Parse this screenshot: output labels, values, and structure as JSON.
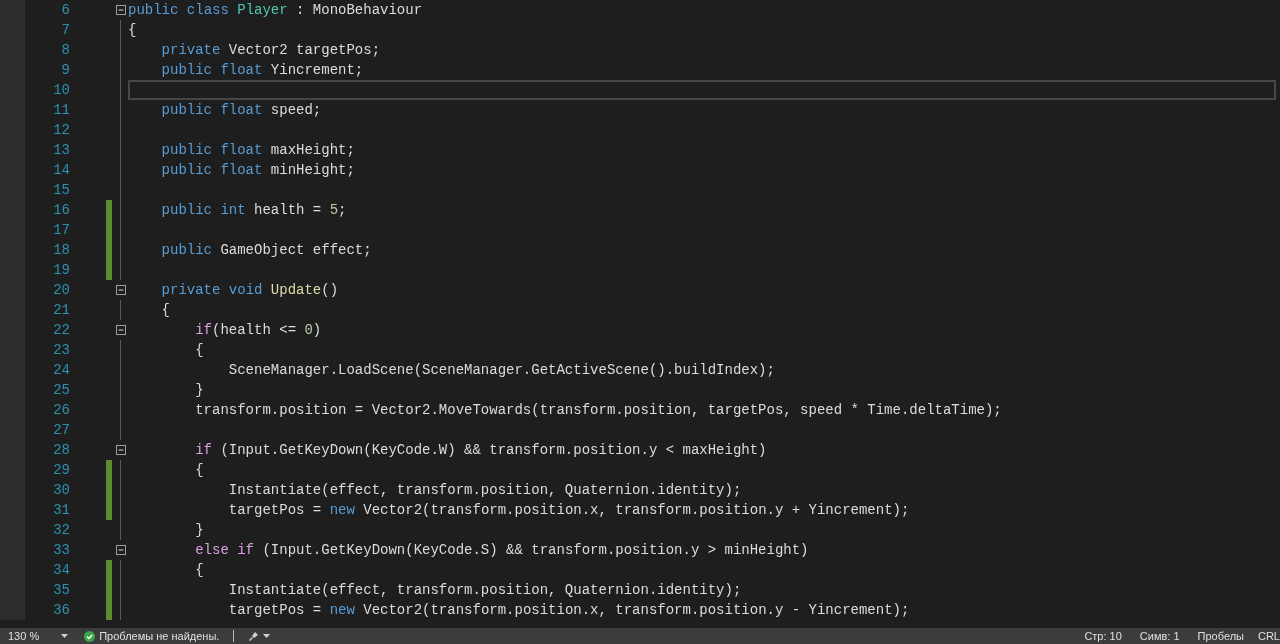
{
  "lines": [
    {
      "number": "6",
      "fold": true,
      "changed": false,
      "current": false,
      "tokens": [
        {
          "kind": "kw",
          "text": "public"
        },
        {
          "kind": "kw",
          "text": " class"
        },
        {
          "kind": "type",
          "text": " Player"
        },
        {
          "kind": "plain",
          "text": " : MonoBehaviour"
        }
      ]
    },
    {
      "number": "7",
      "fold": false,
      "changed": false,
      "current": false,
      "tokens": [
        {
          "kind": "plain",
          "text": "{"
        }
      ]
    },
    {
      "number": "8",
      "fold": false,
      "changed": false,
      "current": false,
      "tokens": [
        {
          "kind": "kw",
          "text": "    private"
        },
        {
          "kind": "plain",
          "text": " Vector2 targetPos;"
        }
      ]
    },
    {
      "number": "9",
      "fold": false,
      "changed": false,
      "current": false,
      "tokens": [
        {
          "kind": "kw",
          "text": "    public"
        },
        {
          "kind": "kw",
          "text": " float"
        },
        {
          "kind": "plain",
          "text": " Yincrement;"
        }
      ]
    },
    {
      "number": "10",
      "fold": false,
      "changed": false,
      "current": true
    },
    {
      "number": "11",
      "fold": false,
      "changed": false,
      "current": false,
      "tokens": [
        {
          "kind": "kw",
          "text": "    public"
        },
        {
          "kind": "kw",
          "text": " float"
        },
        {
          "kind": "plain",
          "text": " speed;"
        }
      ]
    },
    {
      "number": "12",
      "fold": false,
      "changed": false,
      "current": false
    },
    {
      "number": "13",
      "fold": false,
      "changed": false,
      "current": false,
      "tokens": [
        {
          "kind": "kw",
          "text": "    public"
        },
        {
          "kind": "kw",
          "text": " float"
        },
        {
          "kind": "plain",
          "text": " maxHeight;"
        }
      ]
    },
    {
      "number": "14",
      "fold": false,
      "changed": false,
      "current": false,
      "tokens": [
        {
          "kind": "kw",
          "text": "    public"
        },
        {
          "kind": "kw",
          "text": " float"
        },
        {
          "kind": "plain",
          "text": " minHeight;"
        }
      ]
    },
    {
      "number": "15",
      "fold": false,
      "changed": false,
      "current": false
    },
    {
      "number": "16",
      "fold": false,
      "changed": true,
      "current": false,
      "tokens": [
        {
          "kind": "kw",
          "text": "    public"
        },
        {
          "kind": "kw",
          "text": " int"
        },
        {
          "kind": "plain",
          "text": " health = "
        },
        {
          "kind": "num",
          "text": "5"
        },
        {
          "kind": "plain",
          "text": ";"
        }
      ]
    },
    {
      "number": "17",
      "fold": false,
      "changed": true,
      "current": false
    },
    {
      "number": "18",
      "fold": false,
      "changed": true,
      "current": false,
      "tokens": [
        {
          "kind": "kw",
          "text": "    public"
        },
        {
          "kind": "plain",
          "text": " GameObject effect;"
        }
      ]
    },
    {
      "number": "19",
      "fold": false,
      "changed": true,
      "current": false
    },
    {
      "number": "20",
      "fold": true,
      "changed": false,
      "current": false,
      "tokens": [
        {
          "kind": "kw",
          "text": "    private"
        },
        {
          "kind": "kw",
          "text": " void"
        },
        {
          "kind": "method",
          "text": " Update"
        },
        {
          "kind": "plain",
          "text": "()"
        }
      ]
    },
    {
      "number": "21",
      "fold": false,
      "changed": false,
      "current": false,
      "tokens": [
        {
          "kind": "plain",
          "text": "    {"
        }
      ]
    },
    {
      "number": "22",
      "fold": true,
      "changed": false,
      "current": false,
      "tokens": [
        {
          "kind": "ctrl",
          "text": "        if"
        },
        {
          "kind": "plain",
          "text": "(health <= "
        },
        {
          "kind": "num",
          "text": "0"
        },
        {
          "kind": "plain",
          "text": ")"
        }
      ]
    },
    {
      "number": "23",
      "fold": false,
      "changed": false,
      "current": false,
      "tokens": [
        {
          "kind": "plain",
          "text": "        {"
        }
      ]
    },
    {
      "number": "24",
      "fold": false,
      "changed": false,
      "current": false,
      "tokens": [
        {
          "kind": "plain",
          "text": "            SceneManager.LoadScene(SceneManager.GetActiveScene().buildIndex);"
        }
      ]
    },
    {
      "number": "25",
      "fold": false,
      "changed": false,
      "current": false,
      "tokens": [
        {
          "kind": "plain",
          "text": "        }"
        }
      ]
    },
    {
      "number": "26",
      "fold": false,
      "changed": false,
      "current": false,
      "tokens": [
        {
          "kind": "plain",
          "text": "        transform.position = Vector2.MoveTowards(transform.position, targetPos, speed * Time.deltaTime);"
        }
      ]
    },
    {
      "number": "27",
      "fold": false,
      "changed": false,
      "current": false
    },
    {
      "number": "28",
      "fold": true,
      "changed": false,
      "current": false,
      "tokens": [
        {
          "kind": "ctrl",
          "text": "        if"
        },
        {
          "kind": "plain",
          "text": " (Input.GetKeyDown(KeyCode.W) && transform.position.y < maxHeight)"
        }
      ]
    },
    {
      "number": "29",
      "fold": false,
      "changed": true,
      "current": false,
      "tokens": [
        {
          "kind": "plain",
          "text": "        {"
        }
      ]
    },
    {
      "number": "30",
      "fold": false,
      "changed": true,
      "current": false,
      "tokens": [
        {
          "kind": "plain",
          "text": "            Instantiate(effect, transform.position, Quaternion.identity);"
        }
      ]
    },
    {
      "number": "31",
      "fold": false,
      "changed": true,
      "current": false,
      "tokens": [
        {
          "kind": "plain",
          "text": "            targetPos = "
        },
        {
          "kind": "kw",
          "text": "new"
        },
        {
          "kind": "plain",
          "text": " Vector2(transform.position.x, transform.position.y + Yincrement);"
        }
      ]
    },
    {
      "number": "32",
      "fold": false,
      "changed": false,
      "current": false,
      "tokens": [
        {
          "kind": "plain",
          "text": "        }"
        }
      ]
    },
    {
      "number": "33",
      "fold": true,
      "changed": false,
      "current": false,
      "tokens": [
        {
          "kind": "ctrl",
          "text": "        else if"
        },
        {
          "kind": "plain",
          "text": " (Input.GetKeyDown(KeyCode.S) && transform.position.y > minHeight)"
        }
      ]
    },
    {
      "number": "34",
      "fold": false,
      "changed": true,
      "current": false,
      "tokens": [
        {
          "kind": "plain",
          "text": "        {"
        }
      ]
    },
    {
      "number": "35",
      "fold": false,
      "changed": true,
      "current": false,
      "tokens": [
        {
          "kind": "plain",
          "text": "            Instantiate(effect, transform.position, Quaternion.identity);"
        }
      ]
    },
    {
      "number": "36",
      "fold": false,
      "changed": true,
      "current": false,
      "tokens": [
        {
          "kind": "plain",
          "text": "            targetPos = "
        },
        {
          "kind": "kw",
          "text": "new"
        },
        {
          "kind": "plain",
          "text": " Vector2(transform.position.x, transform.position.y - Yincrement);"
        }
      ]
    }
  ],
  "status_bar": {
    "zoom": "130 %",
    "problems": "Проблемы не найдены.",
    "line": "Стр: 10",
    "column": "Симв: 1",
    "whitespace": "Пробелы",
    "line_ending": "CRL"
  }
}
